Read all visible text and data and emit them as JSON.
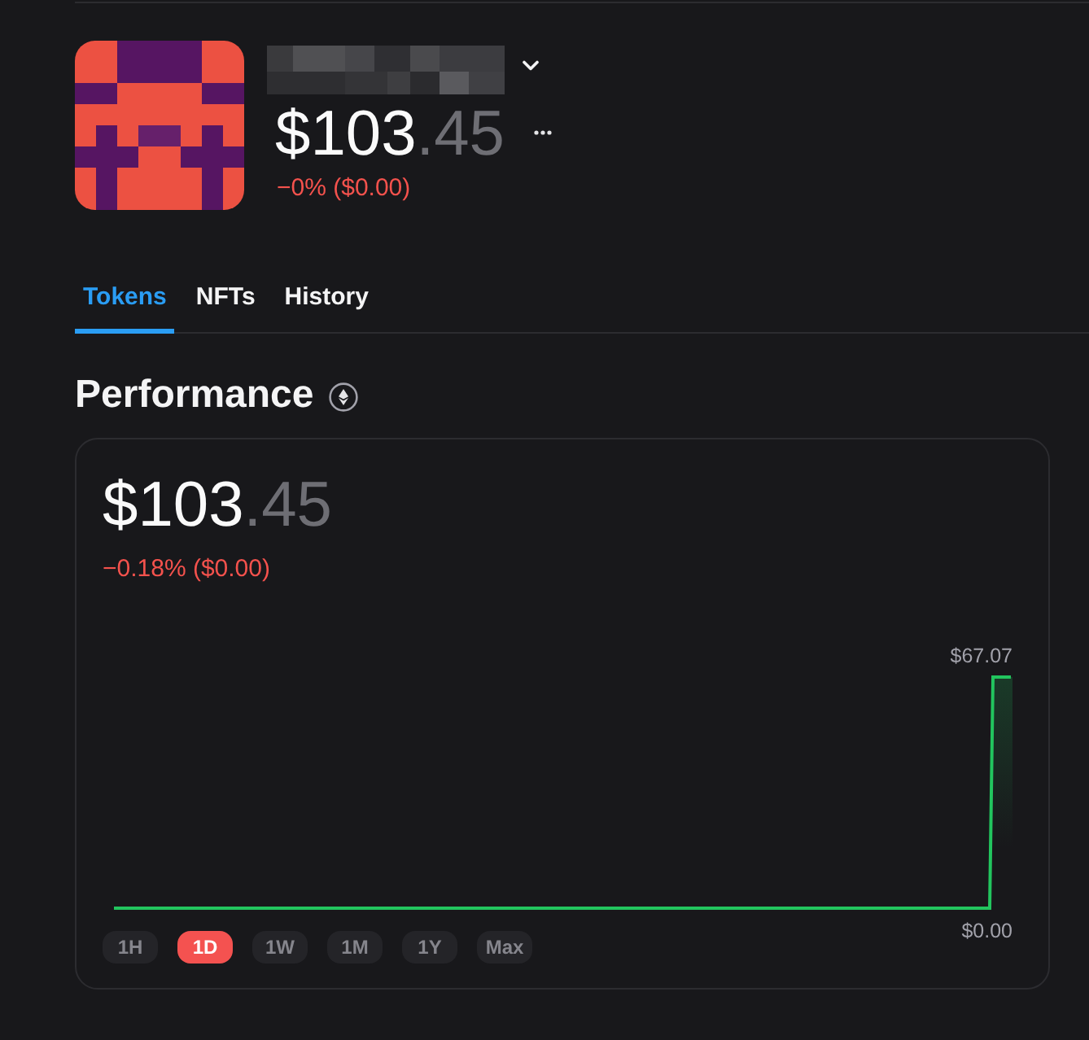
{
  "header": {
    "balance": {
      "whole": "$103",
      "fraction": ".45"
    },
    "change": "−0% ($0.00)"
  },
  "tabs": [
    {
      "label": "Tokens",
      "selected": true
    },
    {
      "label": "NFTs",
      "selected": false
    },
    {
      "label": "History",
      "selected": false
    }
  ],
  "performance": {
    "title": "Performance",
    "balance": {
      "whole": "$103",
      "fraction": ".45"
    },
    "change": "−0.18% ($0.00)",
    "chart": {
      "high_label": "$67.07",
      "low_label": "$0.00"
    },
    "ranges": [
      {
        "label": "1H",
        "selected": false
      },
      {
        "label": "1D",
        "selected": true
      },
      {
        "label": "1W",
        "selected": false
      },
      {
        "label": "1M",
        "selected": false
      },
      {
        "label": "1Y",
        "selected": false
      },
      {
        "label": "Max",
        "selected": false
      }
    ]
  }
}
